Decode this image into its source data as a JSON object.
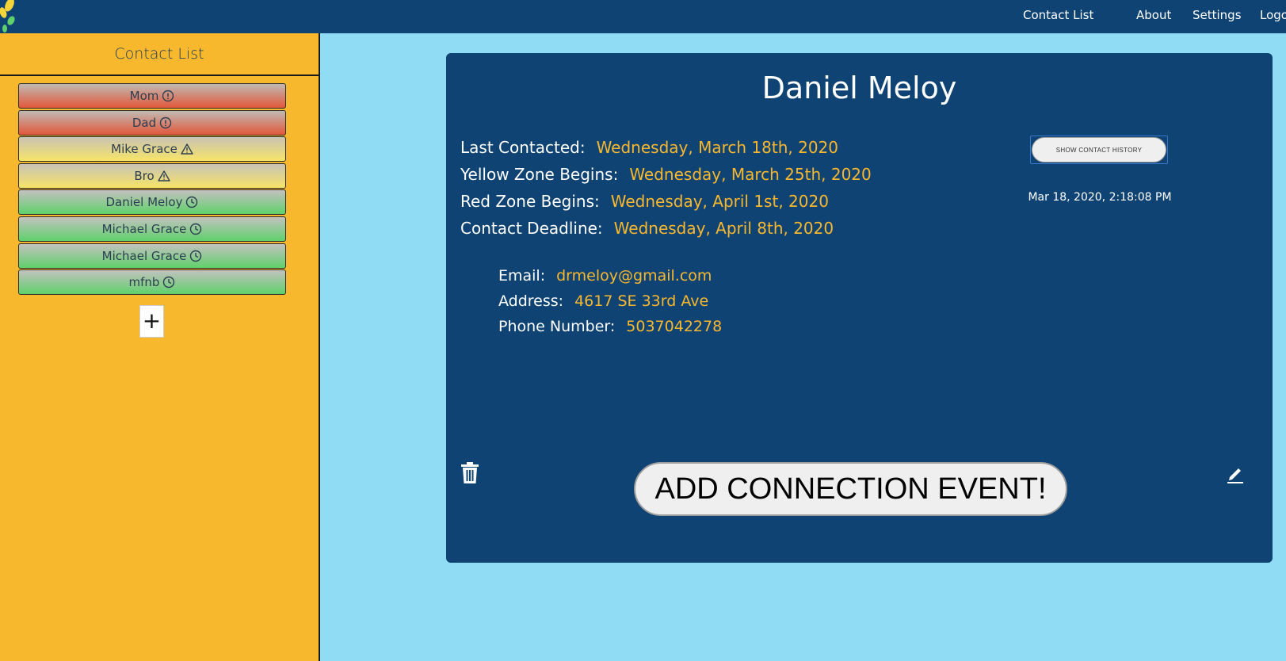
{
  "nav": {
    "links": [
      {
        "label": "Contact List"
      },
      {
        "label": "About"
      },
      {
        "label": "Settings"
      },
      {
        "label": "Logo"
      }
    ]
  },
  "sidebar": {
    "title": "Contact List",
    "contacts": [
      {
        "name": "Mom",
        "status": "red",
        "icon": "alert-circle-icon"
      },
      {
        "name": "Dad",
        "status": "red",
        "icon": "alert-circle-icon"
      },
      {
        "name": "Mike Grace",
        "status": "yellow",
        "icon": "warning-triangle-icon"
      },
      {
        "name": "Bro",
        "status": "yellow",
        "icon": "warning-triangle-icon"
      },
      {
        "name": "Daniel Meloy",
        "status": "green",
        "icon": "clock-icon"
      },
      {
        "name": "Michael Grace",
        "status": "green",
        "icon": "clock-icon"
      },
      {
        "name": "Michael Grace",
        "status": "green",
        "icon": "clock-icon"
      },
      {
        "name": "mfnb",
        "status": "green",
        "icon": "clock-icon"
      }
    ],
    "add_label": "+"
  },
  "card": {
    "name": "Daniel Meloy",
    "last_contacted_label": "Last Contacted:",
    "last_contacted": "Wednesday, March 18th, 2020",
    "yellow_label": "Yellow Zone Begins:",
    "yellow": "Wednesday, March 25th, 2020",
    "red_label": "Red Zone Begins:",
    "red": "Wednesday, April 1st, 2020",
    "deadline_label": "Contact Deadline:",
    "deadline": "Wednesday, April 8th, 2020",
    "email_label": "Email:",
    "email": "drmeloy@gmail.com",
    "address_label": "Address:",
    "address": "4617 SE 33rd Ave",
    "phone_label": "Phone Number:",
    "phone": "5037042278",
    "history_button": "SHOW CONTACT HISTORY",
    "timestamp": "Mar 18, 2020, 2:18:08 PM",
    "add_event_button": "ADD CONNECTION EVENT!"
  },
  "colors": {
    "navbar": "#0f4374",
    "sidebar": "#f8b82e",
    "background": "#8fdcf4",
    "accent": "#f8b82e"
  }
}
